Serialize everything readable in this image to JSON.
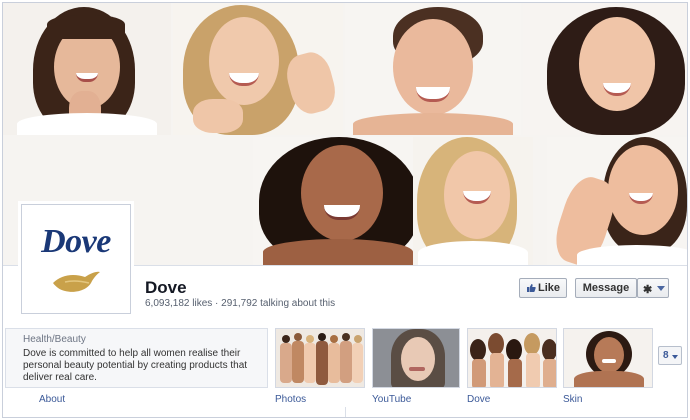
{
  "page": {
    "name": "Dove",
    "likes": "6,093,182 likes",
    "separator": " · ",
    "talking": "291,792 talking about this"
  },
  "profile": {
    "wordmark": "Dove"
  },
  "actions": {
    "like_label": "Like",
    "message_label": "Message",
    "gear_icon": "gear-icon"
  },
  "about": {
    "category": "Health/Beauty",
    "description": "Dove is committed to help all women realise their personal beauty potential by creating products that deliver real care.",
    "nav_label": "About"
  },
  "apps": [
    {
      "label": "Photos"
    },
    {
      "label": "YouTube"
    },
    {
      "label": "Dove"
    },
    {
      "label": "Skin"
    }
  ],
  "more_apps": {
    "count": "8"
  },
  "colors": {
    "link": "#3b5998",
    "dove_blue": "#1a3877",
    "dove_gold": "#c9a14a"
  }
}
